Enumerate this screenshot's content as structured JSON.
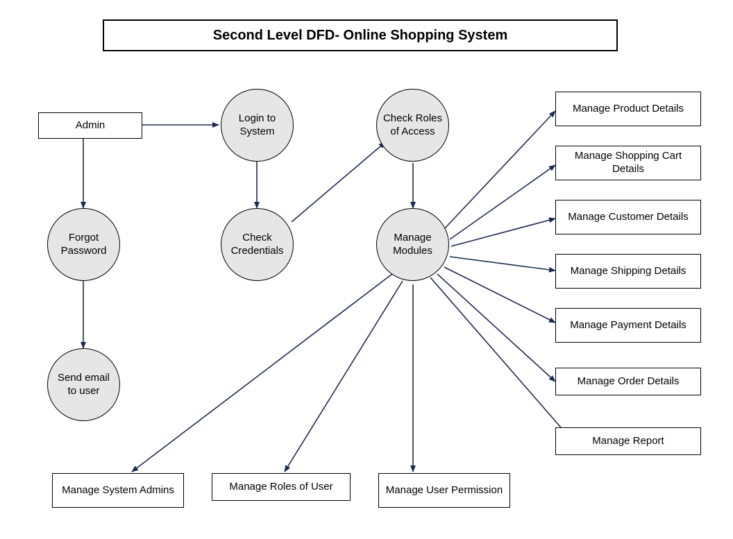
{
  "title": "Second Level DFD- Online Shopping System",
  "entities": {
    "admin": "Admin"
  },
  "processes": {
    "login": "Login to System",
    "forgot": "Forgot Password",
    "sendEmail": "Send email to user",
    "checkCred": "Check Credentials",
    "checkRoles": "Check Roles of Access",
    "manageModules": "Manage Modules"
  },
  "stores": {
    "product": "Manage Product Details",
    "cart": "Manage Shopping Cart Details",
    "customer": "Manage Customer Details",
    "shipping": "Manage Shipping Details",
    "payment": "Manage Payment Details",
    "order": "Manage Order Details",
    "report": "Manage Report",
    "sysAdmins": "Manage System Admins",
    "rolesUser": "Manage Roles of User",
    "userPerm": "Manage User Permission"
  }
}
